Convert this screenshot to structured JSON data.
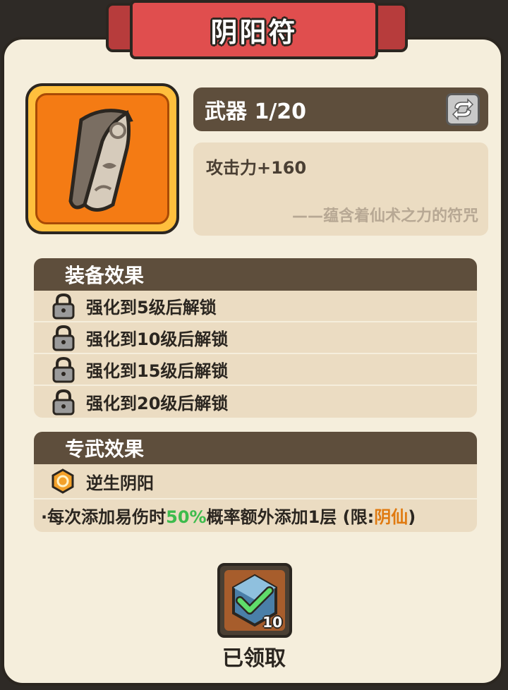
{
  "header": {
    "title": "阴阳符"
  },
  "item": {
    "icon": "talisman-scroll-icon",
    "type_label": "武器 1/20",
    "swap_icon": "swap-arrows-icon",
    "stat": "攻击力+160",
    "flavor": "——蕴含着仙术之力的符咒"
  },
  "equip_effects": {
    "title": "装备效果",
    "items": [
      {
        "label": "强化到5级后解锁",
        "icon": "lock-icon"
      },
      {
        "label": "强化到10级后解锁",
        "icon": "lock-icon"
      },
      {
        "label": "强化到15级后解锁",
        "icon": "lock-icon"
      },
      {
        "label": "强化到20级后解锁",
        "icon": "lock-icon"
      }
    ]
  },
  "exclusive_effects": {
    "title": "专武效果",
    "skill_name": "逆生阴阳",
    "skill_icon": "yinyang-badge-icon",
    "desc_prefix": "·每次添加易伤时",
    "desc_percent": "50%",
    "desc_middle": "概率额外添加1层 (限:",
    "desc_limit": "阴仙",
    "desc_suffix": ")"
  },
  "reward": {
    "icon": "gem-check-icon",
    "count": "10",
    "status_label": "已领取"
  },
  "colors": {
    "banner": "#e04e4e",
    "panel": "#f5eedc",
    "dark_bar": "#5e4e3c",
    "item_bg": "#f47b14",
    "highlight_green": "#3dbb4c",
    "highlight_orange": "#e07a10"
  }
}
